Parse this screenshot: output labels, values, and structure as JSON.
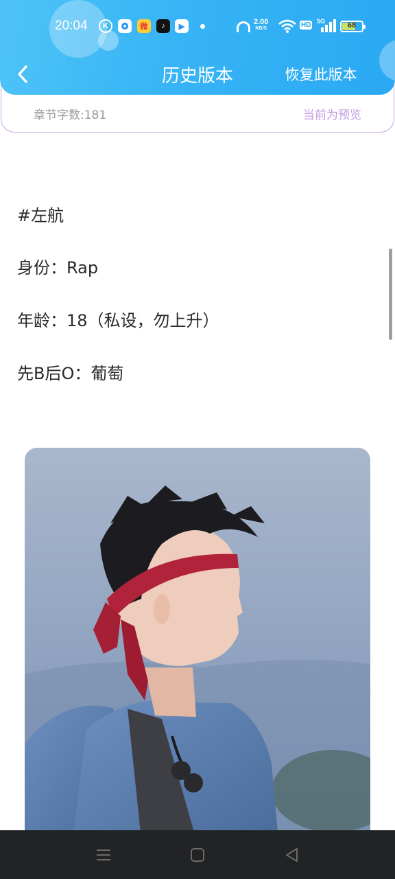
{
  "status_bar": {
    "time": "20:04",
    "app_icons": [
      "k-app-icon",
      "qq-browser-icon",
      "weibo-icon",
      "tiktok-icon",
      "video-app-icon"
    ],
    "net_speed": "2.00",
    "net_speed_unit": "KB/S",
    "hd_label": "HD",
    "network": "5G",
    "battery": "68",
    "battery_level": 0.68
  },
  "header": {
    "title": "历史版本",
    "restore_label": "恢复此版本",
    "back_icon": "chevron-left-icon",
    "accent_color": "#36b4f5"
  },
  "info": {
    "word_count": "章节字数:181",
    "preview_status": "当前为预览",
    "preview_color": "#c39be0"
  },
  "content": {
    "lines": [
      "#左航",
      "身份：Rap",
      "年龄：18（私设，勿上升）",
      "先B后O：葡萄"
    ]
  },
  "system_nav": {
    "icons": [
      "menu-icon",
      "home-icon",
      "back-icon"
    ]
  }
}
